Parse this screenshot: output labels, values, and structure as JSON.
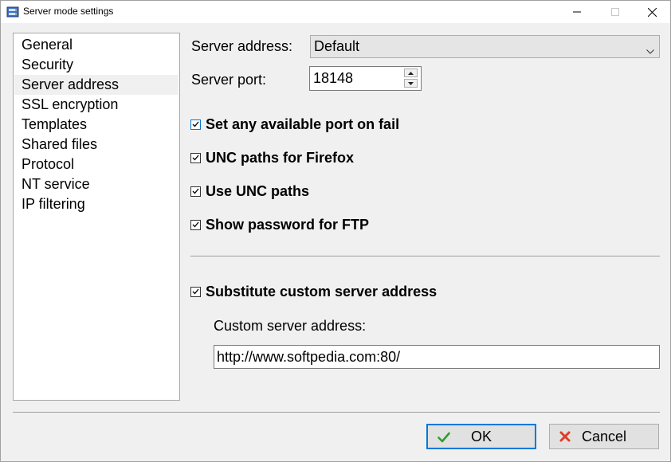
{
  "window": {
    "title": "Server mode settings"
  },
  "nav": {
    "items": [
      {
        "label": "General"
      },
      {
        "label": "Security"
      },
      {
        "label": "Server address"
      },
      {
        "label": "SSL encryption"
      },
      {
        "label": "Templates"
      },
      {
        "label": "Shared files"
      },
      {
        "label": "Protocol"
      },
      {
        "label": "NT service"
      },
      {
        "label": "IP filtering"
      }
    ],
    "selected": "Server address"
  },
  "settings": {
    "server_address_label": "Server address:",
    "server_address_value": "Default",
    "server_port_label": "Server port:",
    "server_port_value": "18148",
    "checkboxes": [
      {
        "label": "Set any available port on fail",
        "checked": true
      },
      {
        "label": "UNC paths for Firefox",
        "checked": true
      },
      {
        "label": "Use UNC paths",
        "checked": true
      },
      {
        "label": "Show password for FTP",
        "checked": true
      }
    ],
    "substitute": {
      "label": "Substitute custom server address",
      "checked": true
    },
    "custom_address_label": "Custom server address:",
    "custom_address_value": "http://www.softpedia.com:80/"
  },
  "buttons": {
    "ok_label": "OK",
    "cancel_label": "Cancel"
  },
  "colors": {
    "accent": "#0078d7",
    "ok_check": "#2e9e2e",
    "cancel_x": "#e03c28"
  },
  "icons": {
    "app": "server-app-icon",
    "minimize": "minimize-icon",
    "maximize": "maximize-icon",
    "close": "close-icon",
    "dropdown": "chevron-down-icon",
    "spin_up": "spin-up-icon",
    "spin_down": "spin-down-icon",
    "ok": "check-icon",
    "cancel": "x-icon"
  }
}
